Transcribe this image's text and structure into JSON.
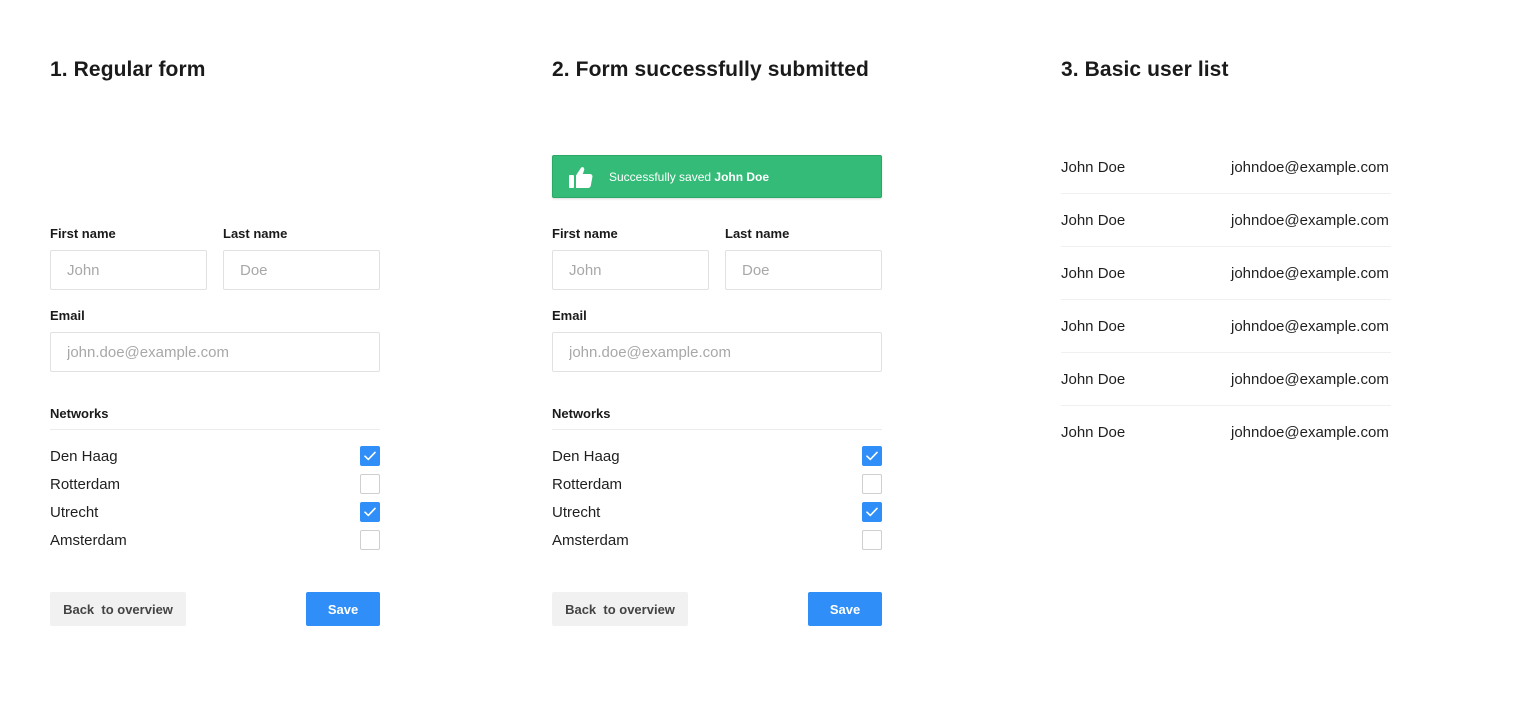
{
  "panel1": {
    "heading": "1. Regular form",
    "first_name_label": "First name",
    "first_name_placeholder": "John",
    "last_name_label": "Last name",
    "last_name_placeholder": "Doe",
    "email_label": "Email",
    "email_placeholder": "john.doe@example.com",
    "networks_label": "Networks",
    "networks": [
      {
        "label": "Den Haag",
        "checked": true
      },
      {
        "label": "Rotterdam",
        "checked": false
      },
      {
        "label": "Utrecht",
        "checked": true
      },
      {
        "label": "Amsterdam",
        "checked": false
      }
    ],
    "back_label": "Back  to overview",
    "save_label": "Save"
  },
  "panel2": {
    "heading": "2. Form successfully submitted",
    "alert_text": "Successfully saved ",
    "alert_name": "John Doe",
    "first_name_label": "First name",
    "first_name_placeholder": "John",
    "last_name_label": "Last name",
    "last_name_placeholder": "Doe",
    "email_label": "Email",
    "email_placeholder": "john.doe@example.com",
    "networks_label": "Networks",
    "networks": [
      {
        "label": "Den Haag",
        "checked": true
      },
      {
        "label": "Rotterdam",
        "checked": false
      },
      {
        "label": "Utrecht",
        "checked": true
      },
      {
        "label": "Amsterdam",
        "checked": false
      }
    ],
    "back_label": "Back  to overview",
    "save_label": "Save"
  },
  "panel3": {
    "heading": "3. Basic user list",
    "users": [
      {
        "name": "John Doe",
        "email": "johndoe@example.com"
      },
      {
        "name": "John Doe",
        "email": "johndoe@example.com"
      },
      {
        "name": "John Doe",
        "email": "johndoe@example.com"
      },
      {
        "name": "John Doe",
        "email": "johndoe@example.com"
      },
      {
        "name": "John Doe",
        "email": "johndoe@example.com"
      },
      {
        "name": "John Doe",
        "email": "johndoe@example.com"
      }
    ]
  },
  "colors": {
    "primary": "#2f8ef7",
    "success": "#33bb77",
    "secondary_button": "#f1f1f1"
  }
}
